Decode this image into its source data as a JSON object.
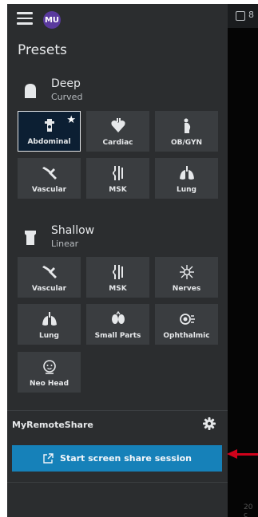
{
  "header": {
    "avatar_initials": "MU"
  },
  "presets": {
    "title": "Presets",
    "probes": [
      {
        "name": "Deep",
        "type": "Curved",
        "tiles": [
          {
            "label": "Abdominal",
            "icon": "abdomen-icon",
            "selected": true,
            "favorite": true
          },
          {
            "label": "Cardiac",
            "icon": "heart-icon"
          },
          {
            "label": "OB/GYN",
            "icon": "pregnancy-icon"
          },
          {
            "label": "Vascular",
            "icon": "vessel-icon"
          },
          {
            "label": "MSK",
            "icon": "knee-icon"
          },
          {
            "label": "Lung",
            "icon": "lungs-icon"
          }
        ]
      },
      {
        "name": "Shallow",
        "type": "Linear",
        "tiles": [
          {
            "label": "Vascular",
            "icon": "vessel-icon"
          },
          {
            "label": "MSK",
            "icon": "knee-icon"
          },
          {
            "label": "Nerves",
            "icon": "nerve-icon"
          },
          {
            "label": "Lung",
            "icon": "lungs-icon"
          },
          {
            "label": "Small Parts",
            "icon": "small-parts-icon"
          },
          {
            "label": "Ophthalmic",
            "icon": "eye-icon"
          },
          {
            "label": "Neo Head",
            "icon": "baby-head-icon"
          }
        ]
      }
    ]
  },
  "remote_share": {
    "title": "MyRemoteShare",
    "button_label": "Start screen share session"
  },
  "right_pane": {
    "top_text": "8",
    "bottom_text": "20 c"
  },
  "colors": {
    "panel": "#2b2d2f",
    "tile": "#3a3d40",
    "selected_tile": "#0c1f33",
    "accent": "#1681b9",
    "annotation_arrow": "#d0021b"
  }
}
